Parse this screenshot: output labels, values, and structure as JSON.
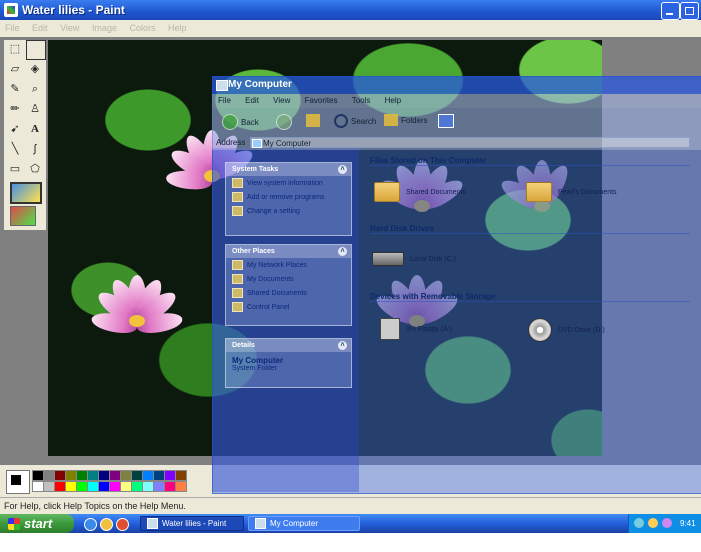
{
  "paint": {
    "title": "Water lilies - Paint",
    "menu": [
      "File",
      "Edit",
      "View",
      "Image",
      "Colors",
      "Help"
    ],
    "status": "For Help, click Help Topics on the Help Menu."
  },
  "toolbox": {
    "tools": [
      "free-select-icon",
      "rect-select-icon",
      "eraser-icon",
      "fill-icon",
      "color-picker-icon",
      "magnifier-icon",
      "pencil-icon",
      "brush-icon",
      "airbrush-icon",
      "text-icon",
      "line-icon",
      "curve-icon",
      "rectangle-icon",
      "polygon-icon",
      "ellipse-icon",
      "rounded-rect-icon"
    ],
    "text_glyph": "A"
  },
  "palette": {
    "row1": [
      "#000000",
      "#808080",
      "#800000",
      "#808000",
      "#008000",
      "#008080",
      "#000080",
      "#800080",
      "#808040",
      "#004040",
      "#0080ff",
      "#004080",
      "#8000ff",
      "#804000"
    ],
    "row2": [
      "#ffffff",
      "#c0c0c0",
      "#ff0000",
      "#ffff00",
      "#00ff00",
      "#00ffff",
      "#0000ff",
      "#ff00ff",
      "#ffff80",
      "#00ff80",
      "#80ffff",
      "#8080ff",
      "#ff0080",
      "#ff8040"
    ]
  },
  "mycomputer": {
    "title": "My Computer",
    "menu": [
      "File",
      "Edit",
      "View",
      "Favorites",
      "Tools",
      "Help"
    ],
    "toolbar": {
      "back": "Back",
      "search": "Search",
      "folders": "Folders"
    },
    "address": {
      "label": "Address",
      "value": "My Computer"
    },
    "system_tasks": {
      "header": "System Tasks",
      "items": [
        "View system information",
        "Add or remove programs",
        "Change a setting"
      ]
    },
    "other_places": {
      "header": "Other Places",
      "items": [
        "My Network Places",
        "My Documents",
        "Shared Documents",
        "Control Panel"
      ]
    },
    "details": {
      "header": "Details",
      "name": "My Computer",
      "type": "System Folder"
    },
    "sections": {
      "files": "Files Stored on This Computer",
      "drives": "Hard Disk Drives",
      "removable": "Devices with Removable Storage"
    },
    "items": {
      "shared_docs": "Shared Documents",
      "user_docs": "Pearl's Documents",
      "local_disk": "Local Disk (C:)",
      "floppy": "3½ Floppy (A:)",
      "dvd": "DVD Drive (D:)"
    }
  },
  "taskbar": {
    "start": "start",
    "tasks": [
      "Water lilies - Paint",
      "My Computer"
    ],
    "clock": "9:41 PM"
  }
}
